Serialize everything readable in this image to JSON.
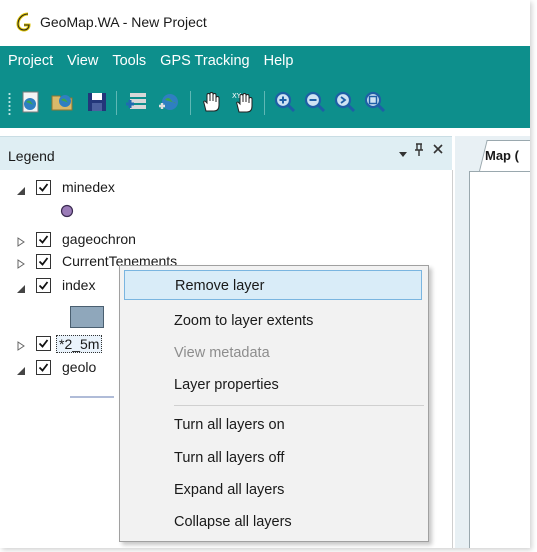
{
  "window": {
    "title": "GeoMap.WA - New Project"
  },
  "menubar": {
    "items": [
      "Project",
      "View",
      "Tools",
      "GPS Tracking",
      "Help"
    ]
  },
  "toolbar": {
    "buttons": [
      {
        "icon": "new-project-icon"
      },
      {
        "icon": "open-project-icon"
      },
      {
        "icon": "save-icon"
      },
      {
        "icon": "add-layer-icon"
      },
      {
        "icon": "add-web-layer-icon"
      },
      {
        "icon": "pan-hand-icon"
      },
      {
        "icon": "xy-pan-hand-icon"
      },
      {
        "icon": "zoom-in-icon"
      },
      {
        "icon": "zoom-out-icon"
      },
      {
        "icon": "zoom-previous-icon"
      },
      {
        "icon": "zoom-extent-icon"
      }
    ]
  },
  "legend": {
    "title": "Legend",
    "pin_glyph": "↕",
    "close_glyph": "✕",
    "layers": [
      {
        "label": "minedex",
        "checked": true,
        "expanded": true,
        "symbol_color": "#9b7cb8"
      },
      {
        "label": "gageochron",
        "checked": true,
        "expanded": false
      },
      {
        "label": "CurrentTenements",
        "checked": true,
        "expanded": false
      },
      {
        "label": "index",
        "checked": true,
        "expanded": true,
        "symbol_color": "#8fa7bb"
      },
      {
        "label": "*2_5m",
        "checked": true,
        "expanded": false
      },
      {
        "label": "geolo",
        "checked": true,
        "expanded": true
      }
    ]
  },
  "map": {
    "tab_label": "Map ("
  },
  "context_menu": {
    "items": [
      {
        "label": "Remove layer",
        "state": "highlighted"
      },
      {
        "label": "Zoom to layer extents",
        "state": "enabled"
      },
      {
        "label": "View metadata",
        "state": "disabled"
      },
      {
        "label": "Layer properties",
        "state": "enabled"
      },
      {
        "label": "Turn all layers on",
        "state": "enabled"
      },
      {
        "label": "Turn all layers off",
        "state": "enabled"
      },
      {
        "label": "Expand all layers",
        "state": "enabled"
      },
      {
        "label": "Collapse all layers",
        "state": "enabled"
      }
    ]
  },
  "colors": {
    "menubar_bg": "#0d8f8c",
    "legend_header_bg": "#dfeef3",
    "menu_highlight": "#d9ecf8"
  }
}
